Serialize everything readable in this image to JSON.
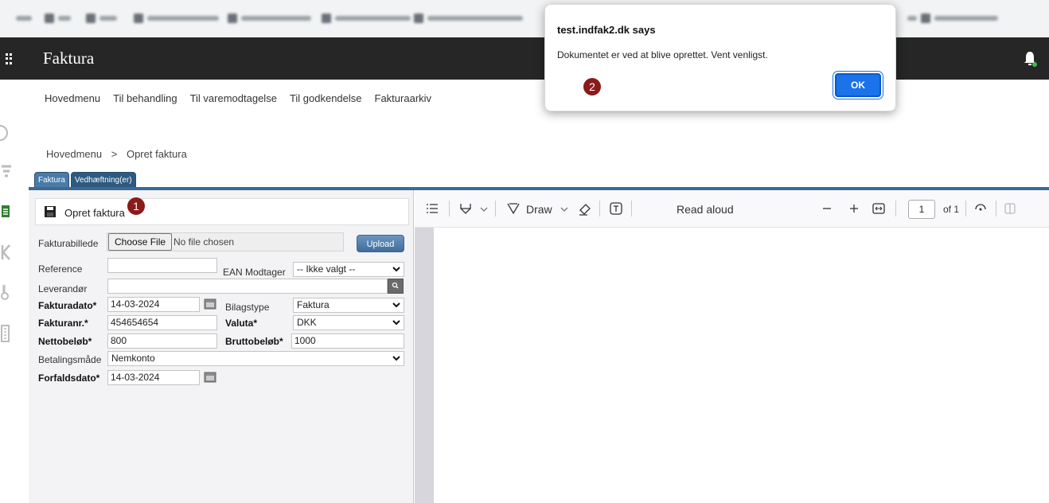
{
  "header": {
    "title": "Faktura"
  },
  "nav": {
    "items": [
      "Hovedmenu",
      "Til behandling",
      "Til varemodtagelse",
      "Til godkendelse",
      "Fakturaarkiv"
    ]
  },
  "breadcrumb": {
    "home": "Hovedmenu",
    "separator": ">",
    "current": "Opret faktura"
  },
  "tabs": [
    "Faktura",
    "Vedhæftning(er)"
  ],
  "form": {
    "title": "Opret faktura",
    "marker1": "1",
    "fakturabillede_label": "Fakturabillede",
    "choose_file": "Choose File",
    "no_file": "No file chosen",
    "upload": "Upload",
    "reference_label": "Reference",
    "reference_value": "",
    "ean_label": "EAN Modtager",
    "ean_value": "-- Ikke valgt --",
    "leverandor_label": "Leverandør",
    "leverandor_value": "",
    "fakturadato_label": "Fakturadato*",
    "fakturadato_value": "14-03-2024",
    "bilagstype_label": "Bilagstype",
    "bilagstype_value": "Faktura",
    "fakturanr_label": "Fakturanr.*",
    "fakturanr_value": "454654654",
    "valuta_label": "Valuta*",
    "valuta_value": "DKK",
    "netto_label": "Nettobeløb*",
    "netto_value": "800",
    "brutto_label": "Bruttobeløb*",
    "brutto_value": "1000",
    "betaling_label": "Betalingsmåde",
    "betaling_value": "Nemkonto",
    "forfald_label": "Forfaldsdato*",
    "forfald_value": "14-03-2024"
  },
  "viewer": {
    "draw": "Draw",
    "read_aloud": "Read aloud",
    "page": "1",
    "of": "of 1"
  },
  "dialog": {
    "title": "test.indfak2.dk says",
    "message": "Dokumentet er ved at blive oprettet. Vent venligst.",
    "marker2": "2",
    "ok": "OK"
  },
  "colors": {
    "appbar": "#262626",
    "tab_line": "#3b6a95",
    "marker": "#8b1a1a",
    "ok_button": "#1a73e8"
  }
}
